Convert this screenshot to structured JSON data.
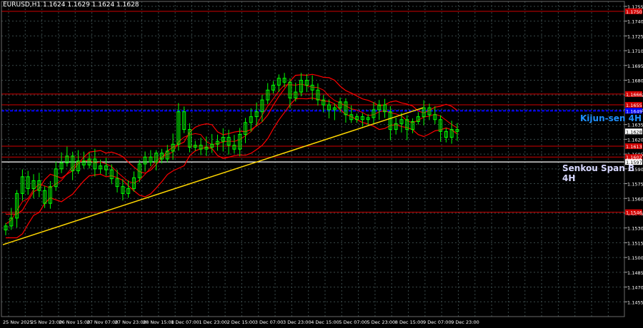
{
  "window": {
    "symbol_info": "EURUSD,H1  1.1624 1.1629 1.1624 1.1628"
  },
  "colors": {
    "background": "#000000",
    "grid": "#3a4a4a",
    "axis_text": "#ffffff",
    "bull_candle": "#00ff00",
    "ichimoku": "#ff0000",
    "support_resistance": "#d00000",
    "kijun_line": "#0000ff",
    "senkou_line": "#ffffff",
    "trend_line": "#ffd700",
    "kijun_label": "#1e90ff",
    "senkou_label": "#d8d8ff"
  },
  "chart_data": {
    "type": "line",
    "title": "",
    "xlabel": "",
    "ylabel": "",
    "ylim": [
      1.144,
      1.176
    ],
    "y_ticks": [
      "1.1755",
      "1.1740",
      "1.1725",
      "1.1710",
      "1.1695",
      "1.1680",
      "1.1665",
      "1.1650",
      "1.1635",
      "1.1620",
      "1.1605",
      "1.1590",
      "1.1575",
      "1.1560",
      "1.1545",
      "1.1530",
      "1.1515",
      "1.1500",
      "1.1485",
      "1.1470",
      "1.1455"
    ],
    "x_ticks": [
      "25 Nov 2025",
      "25 Nov 23:00",
      "26 Nov 15:00",
      "27 Nov 07:00",
      "27 Nov 23:00",
      "28 Nov 15:00",
      "1 Dec 07:00",
      "1 Dec 23:00",
      "2 Dec 15:00",
      "3 Dec 07:00",
      "3 Dec 23:00",
      "4 Dec 15:00",
      "5 Dec 07:00",
      "5 Dec 23:00",
      "8 Dec 15:00",
      "9 Dec 07:00",
      "9 Dec 23:00"
    ],
    "price_series": [
      1.1532,
      1.154,
      1.1565,
      1.1582,
      1.157,
      1.1578,
      1.1568,
      1.1555,
      1.1572,
      1.159,
      1.1596,
      1.1603,
      1.1588,
      1.1598,
      1.1594,
      1.16,
      1.159,
      1.1593,
      1.1589,
      1.158,
      1.1572,
      1.1565,
      1.157,
      1.1581,
      1.1595,
      1.1602,
      1.1597,
      1.1606,
      1.16,
      1.1608,
      1.1615,
      1.1648,
      1.163,
      1.1612,
      1.1614,
      1.161,
      1.1612,
      1.1615,
      1.1618,
      1.1622,
      1.1614,
      1.161,
      1.1625,
      1.1637,
      1.1643,
      1.1648,
      1.166,
      1.167,
      1.1675,
      1.1682,
      1.1678,
      1.1662,
      1.1668,
      1.168,
      1.1675,
      1.167,
      1.166,
      1.1655,
      1.165,
      1.1652,
      1.1658,
      1.1645,
      1.164,
      1.1643,
      1.164,
      1.1642,
      1.165,
      1.1655,
      1.1648,
      1.163,
      1.1636,
      1.164,
      1.163,
      1.1638,
      1.1643,
      1.1652,
      1.1645,
      1.164,
      1.1628,
      1.1622,
      1.163,
      1.1628
    ],
    "kijun_sen_4h": 1.1649,
    "senkou_span_b_4h": 1.1597,
    "red_levels": [
      1.175,
      1.1666,
      1.1655,
      1.1613,
      1.1602,
      1.1546
    ],
    "trend_line": {
      "from": [
        "25 Nov 2025",
        1.1513
      ],
      "to": [
        "9 Dec 07:00",
        1.1652
      ]
    },
    "price_labels": [
      "1.1750",
      "1.1666",
      "1.1655",
      "1.1649",
      "1.1628",
      "1.1613",
      "1.1602",
      "1.1597",
      "1.1546"
    ],
    "line_labels": {
      "kijun": "Kijun-sen 4H",
      "senkou": "Senkou Span B 4H"
    }
  }
}
